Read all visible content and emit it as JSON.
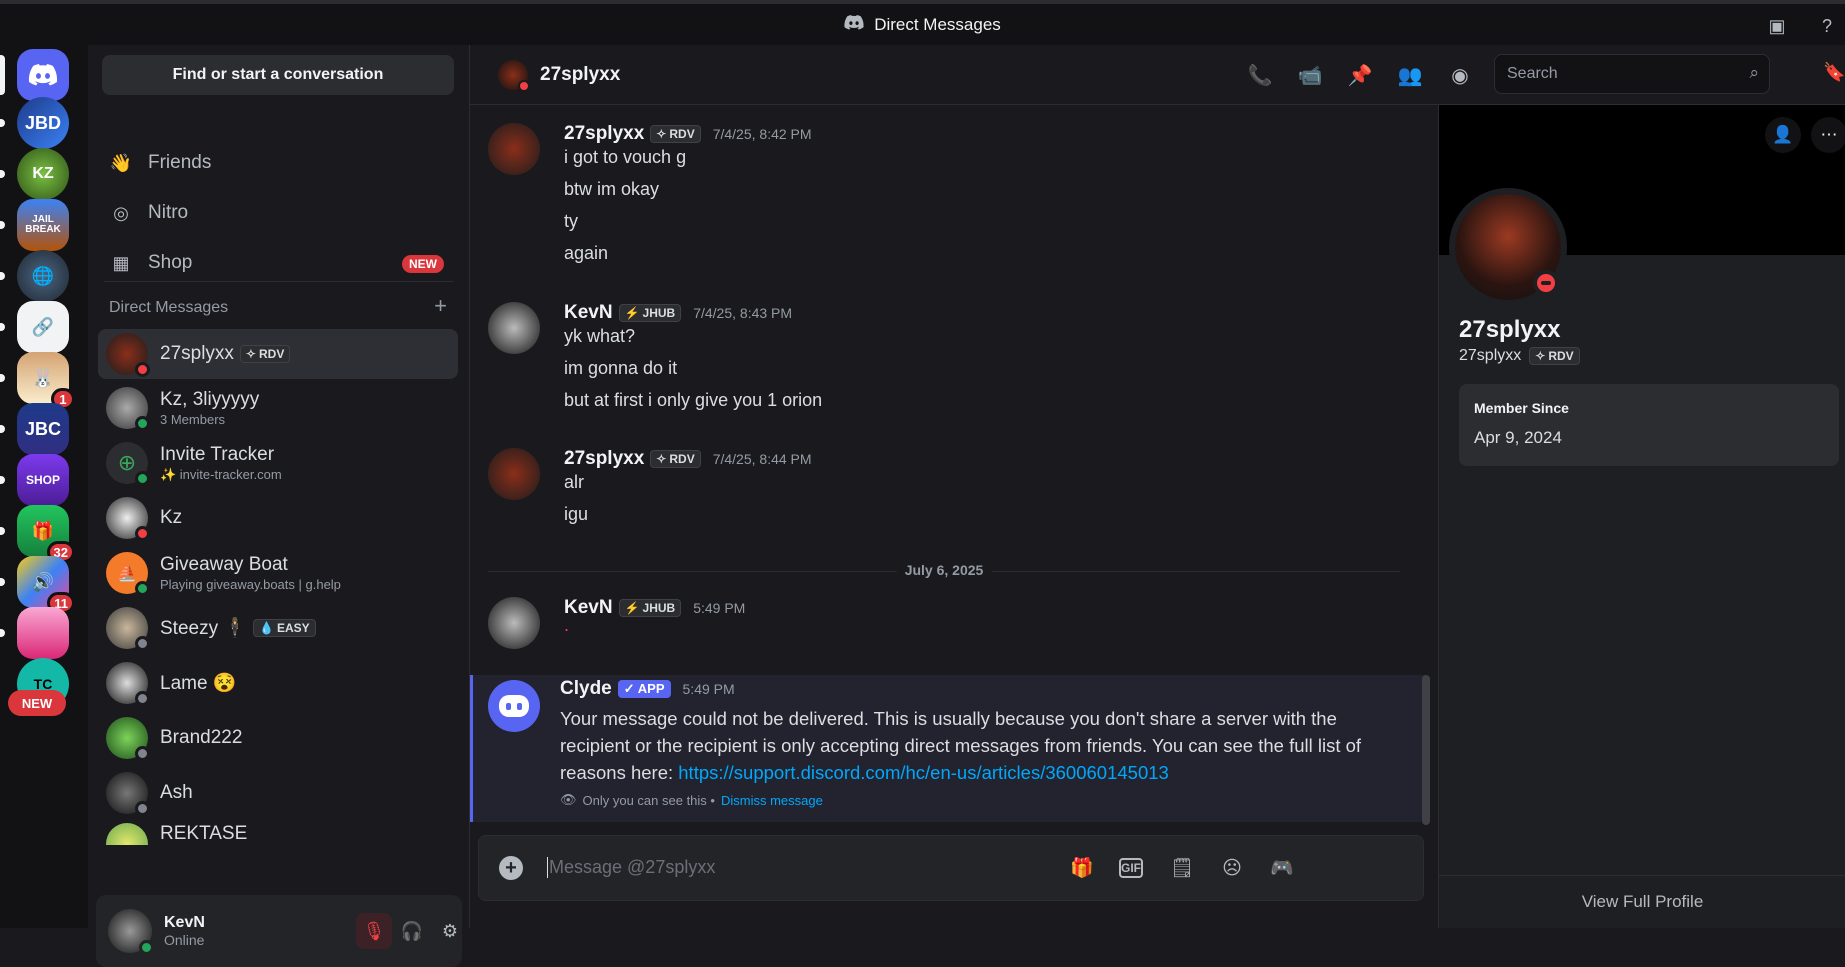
{
  "titlebar": {
    "title": "Direct Messages"
  },
  "guilds": {
    "items": [
      {
        "name": "discord-home",
        "label": "",
        "badge": ""
      },
      {
        "name": "JBD",
        "label": "JBD",
        "badge": ""
      },
      {
        "name": "KZ",
        "label": "KZ",
        "badge": ""
      },
      {
        "name": "Jailbreak",
        "label": "JAIL BREAK",
        "badge": ""
      },
      {
        "name": "Globe",
        "label": "",
        "badge": ""
      },
      {
        "name": "Pinned",
        "label": "",
        "badge": ""
      },
      {
        "name": "Bunny",
        "label": "",
        "badge": "1"
      },
      {
        "name": "JBC",
        "label": "JBC",
        "badge": ""
      },
      {
        "name": "Shop",
        "label": "SHOP",
        "badge": ""
      },
      {
        "name": "Sale",
        "label": "",
        "badge": "32"
      },
      {
        "name": "Colorful",
        "label": "",
        "badge": "11"
      },
      {
        "name": "Pink",
        "label": "",
        "badge": ""
      },
      {
        "name": "TC",
        "label": "TC",
        "badge": ""
      }
    ],
    "new_label": "NEW"
  },
  "sidebar": {
    "find_label": "Find or start a conversation",
    "nav": [
      {
        "label": "Friends",
        "icon": "friends-icon"
      },
      {
        "label": "Nitro",
        "icon": "nitro-icon"
      },
      {
        "label": "Shop",
        "icon": "shop-icon",
        "badge": "NEW"
      }
    ],
    "dm_header": "Direct Messages",
    "dms": [
      {
        "name": "27splyxx",
        "tag": "RDV",
        "sub": "",
        "status": "dnd",
        "active": true
      },
      {
        "name": "Kz, 3liyyyyy",
        "tag": "",
        "sub": "3 Members",
        "status": "online"
      },
      {
        "name": "Invite Tracker",
        "tag": "",
        "sub": "✨ invite-tracker.com",
        "status": "online"
      },
      {
        "name": "Kz",
        "tag": "",
        "sub": "",
        "status": "dnd"
      },
      {
        "name": "Giveaway Boat",
        "tag": "",
        "sub": "Playing giveaway.boats | g.help",
        "status": "online"
      },
      {
        "name": "Steezy 🕴",
        "tag": "EASY",
        "sub": "",
        "status": "offline"
      },
      {
        "name": "Lame 😵",
        "tag": "",
        "sub": "",
        "status": "offline"
      },
      {
        "name": "Brand222",
        "tag": "",
        "sub": "",
        "status": "offline"
      },
      {
        "name": "Ash",
        "tag": "",
        "sub": "",
        "status": "offline"
      },
      {
        "name": "REKTASE",
        "tag": "",
        "sub": "",
        "status": "offline"
      }
    ],
    "user": {
      "name": "KevN",
      "status": "Online"
    }
  },
  "chat": {
    "header_name": "27splyxx",
    "search_placeholder": "Search",
    "messages": [
      {
        "author": "27splyxx",
        "tag": "RDV",
        "time": "7/4/25, 8:42 PM",
        "lines": [
          "i got to vouch g",
          "btw im okay",
          "ty",
          "again"
        ]
      },
      {
        "author": "KevN",
        "tag": "JHUB",
        "time": "7/4/25, 8:43 PM",
        "lines": [
          "yk what?",
          "im gonna do it",
          "but at first i only give you 1 orion"
        ]
      },
      {
        "author": "27splyxx",
        "tag": "RDV",
        "time": "7/4/25, 8:44 PM",
        "lines": [
          "alr",
          "igu"
        ]
      },
      {
        "author": "KevN",
        "tag": "JHUB",
        "time": "5:49 PM",
        "lines": [
          "."
        ]
      }
    ],
    "date_separator": "July 6, 2025",
    "clyde": {
      "author": "Clyde",
      "tag": "✓ APP",
      "time": "5:49 PM",
      "text": "Your message could not be delivered. This is usually because you don't share a server with the recipient or the recipient is only accepting direct messages from friends. You can see the full list of reasons here: ",
      "link": "https://support.discord.com/hc/en-us/articles/360060145013",
      "note": "Only you can see this •",
      "dismiss": "Dismiss message"
    },
    "composer_placeholder": "Message @27splyxx"
  },
  "profile": {
    "display_name": "27splyxx",
    "username": "27splyxx",
    "tag": "RDV",
    "member_since_label": "Member Since",
    "member_since": "Apr 9, 2024",
    "view_full": "View Full Profile"
  },
  "colors": {
    "accent": "#5865f2",
    "danger": "#da373c",
    "online": "#23a55a",
    "dnd": "#f23f43",
    "link": "#00a8fc"
  }
}
